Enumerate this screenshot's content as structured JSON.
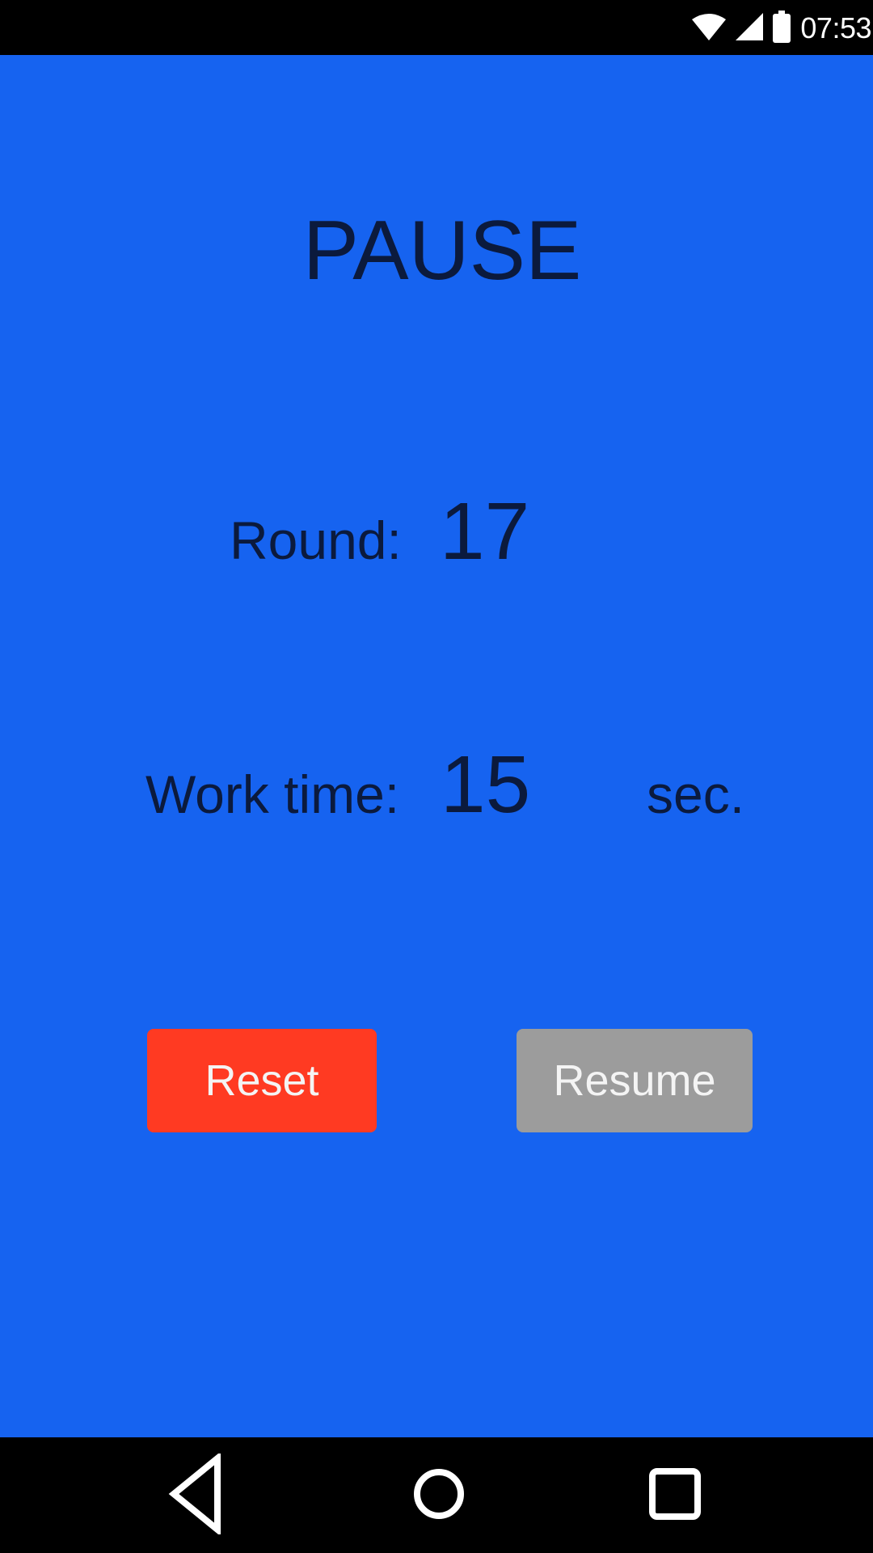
{
  "status_bar": {
    "time": "07:53",
    "icons": [
      "wifi-icon",
      "cell-signal-icon",
      "battery-icon"
    ]
  },
  "app": {
    "background_color": "#1663F0",
    "title": "PAUSE",
    "round": {
      "label": "Round:",
      "value": "17"
    },
    "work_time": {
      "label": "Work time:",
      "value": "15",
      "unit": "sec."
    },
    "buttons": {
      "reset_label": "Reset",
      "reset_color": "#FF3A22",
      "resume_label": "Resume",
      "resume_color": "#9C9C9C"
    }
  },
  "nav_bar": {
    "icons": [
      "back-icon",
      "home-icon",
      "recents-icon"
    ]
  }
}
